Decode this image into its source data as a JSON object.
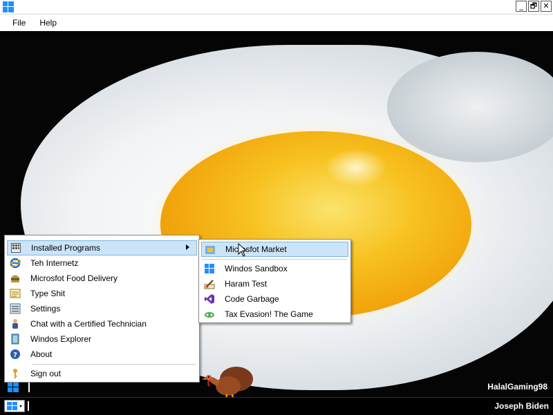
{
  "menubar": {
    "items": [
      "File",
      "Help"
    ]
  },
  "titlebar": {
    "buttons": [
      "_",
      "🗗",
      "✕"
    ]
  },
  "start_menu": {
    "items": [
      {
        "label": "Installed Programs",
        "icon": "grid-icon",
        "has_submenu": true,
        "active": true
      },
      {
        "label": "Teh Internetz",
        "icon": "internet-explorer-icon"
      },
      {
        "label": "Microsfot Food Delivery",
        "icon": "burger-icon"
      },
      {
        "label": "Type Shit",
        "icon": "notepad-icon"
      },
      {
        "label": "Settings",
        "icon": "settings-icon"
      },
      {
        "label": "Chat with a Certified Technician",
        "icon": "person-icon"
      },
      {
        "label": "Windos Explorer",
        "icon": "folder-icon"
      },
      {
        "label": "About",
        "icon": "help-icon"
      },
      {
        "label": "Sign out",
        "icon": "key-icon"
      }
    ]
  },
  "submenu": {
    "items": [
      {
        "label": "Microsfot Market",
        "icon": "market-icon",
        "active": true
      },
      {
        "label": "Windos Sandbox",
        "icon": "windows-icon"
      },
      {
        "label": "Haram Test",
        "icon": "paint-icon"
      },
      {
        "label": "Code Garbage",
        "icon": "visual-studio-icon"
      },
      {
        "label": "Tax Evasion! The Game",
        "icon": "game-icon"
      }
    ]
  },
  "inner_taskbar": {
    "user": "HalalGaming98"
  },
  "taskbar": {
    "user": "Joseph Biden"
  }
}
